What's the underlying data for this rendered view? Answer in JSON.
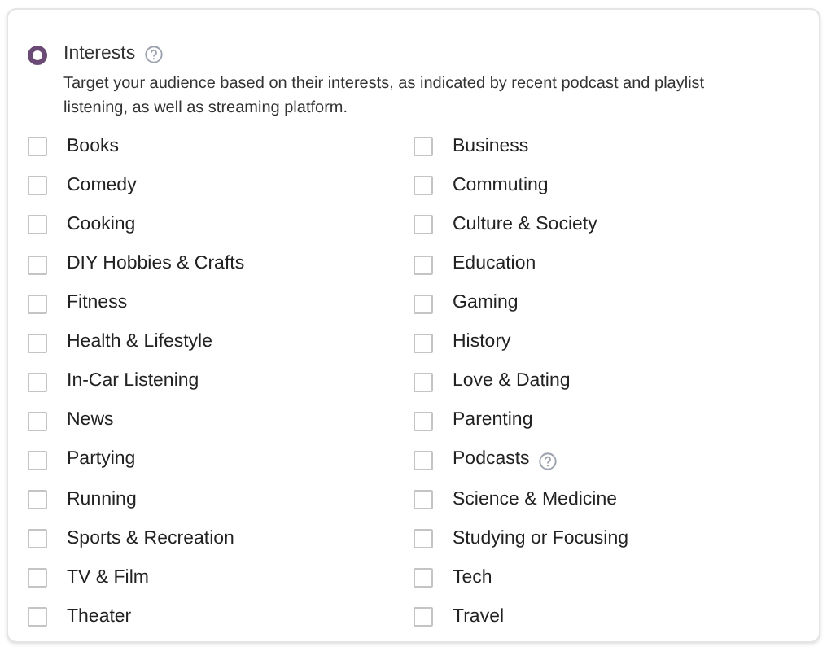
{
  "option": {
    "label": "Interests",
    "selected": true,
    "help": true,
    "description": "Target your audience based on their interests, as indicated by recent podcast and playlist listening, as well as streaming platform."
  },
  "interests": [
    {
      "label": "Books",
      "checked": false,
      "help": false
    },
    {
      "label": "Business",
      "checked": false,
      "help": false
    },
    {
      "label": "Comedy",
      "checked": false,
      "help": false
    },
    {
      "label": "Commuting",
      "checked": false,
      "help": false
    },
    {
      "label": "Cooking",
      "checked": false,
      "help": false
    },
    {
      "label": "Culture & Society",
      "checked": false,
      "help": false
    },
    {
      "label": "DIY Hobbies & Crafts",
      "checked": false,
      "help": false
    },
    {
      "label": "Education",
      "checked": false,
      "help": false
    },
    {
      "label": "Fitness",
      "checked": false,
      "help": false
    },
    {
      "label": "Gaming",
      "checked": false,
      "help": false
    },
    {
      "label": "Health & Lifestyle",
      "checked": false,
      "help": false
    },
    {
      "label": "History",
      "checked": false,
      "help": false
    },
    {
      "label": "In-Car Listening",
      "checked": false,
      "help": false
    },
    {
      "label": "Love & Dating",
      "checked": false,
      "help": false
    },
    {
      "label": "News",
      "checked": false,
      "help": false
    },
    {
      "label": "Parenting",
      "checked": false,
      "help": false
    },
    {
      "label": "Partying",
      "checked": false,
      "help": false
    },
    {
      "label": "Podcasts",
      "checked": false,
      "help": true
    },
    {
      "label": "Running",
      "checked": false,
      "help": false
    },
    {
      "label": "Science & Medicine",
      "checked": false,
      "help": false
    },
    {
      "label": "Sports & Recreation",
      "checked": false,
      "help": false
    },
    {
      "label": "Studying or Focusing",
      "checked": false,
      "help": false
    },
    {
      "label": "TV & Film",
      "checked": false,
      "help": false
    },
    {
      "label": "Tech",
      "checked": false,
      "help": false
    },
    {
      "label": "Theater",
      "checked": false,
      "help": false
    },
    {
      "label": "Travel",
      "checked": false,
      "help": false
    }
  ]
}
